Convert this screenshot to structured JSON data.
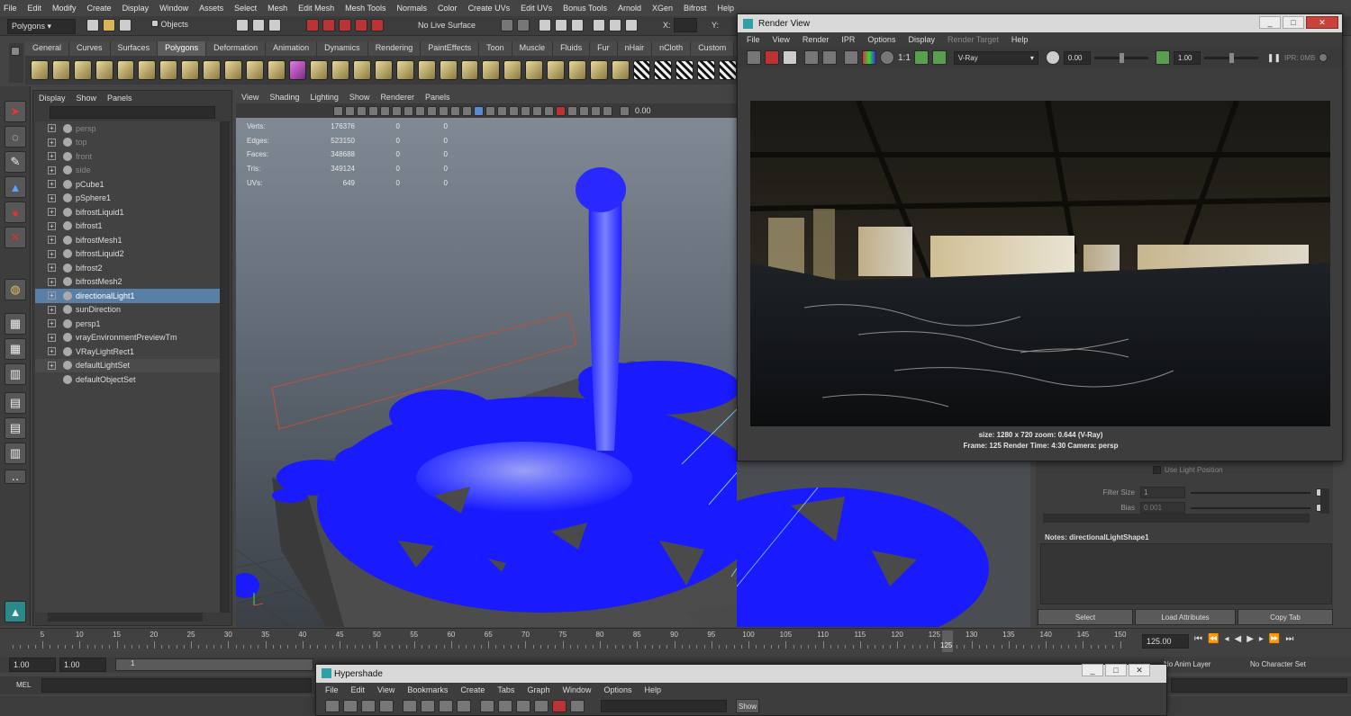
{
  "main_menu": [
    "File",
    "Edit",
    "Modify",
    "Create",
    "Display",
    "Window",
    "Assets",
    "Select",
    "Mesh",
    "Edit Mesh",
    "Mesh Tools",
    "Normals",
    "Color",
    "Create UVs",
    "Edit UVs",
    "Bonus Tools",
    "Arnold",
    "XGen",
    "Bifrost",
    "Help"
  ],
  "status_line": {
    "mode": "Polygons",
    "selection_mode": "Objects",
    "live_surface": "No Live Surface",
    "x_label": "X:",
    "y_label": "Y:"
  },
  "shelf_tabs": [
    "General",
    "Curves",
    "Surfaces",
    "Polygons",
    "Deformation",
    "Animation",
    "Dynamics",
    "Rendering",
    "PaintEffects",
    "Toon",
    "Muscle",
    "Fluids",
    "Fur",
    "nHair",
    "nCloth",
    "Custom"
  ],
  "shelf_active": "Polygons",
  "outliner": {
    "menu": [
      "Display",
      "Show",
      "Panels"
    ],
    "items": [
      {
        "label": "persp",
        "state": "dim"
      },
      {
        "label": "top",
        "state": "dim"
      },
      {
        "label": "front",
        "state": "dim"
      },
      {
        "label": "side",
        "state": "dim"
      },
      {
        "label": "pCube1",
        "state": "normal"
      },
      {
        "label": "pSphere1",
        "state": "normal"
      },
      {
        "label": "bifrostLiquid1",
        "state": "normal"
      },
      {
        "label": "bifrost1",
        "state": "normal"
      },
      {
        "label": "bifrostMesh1",
        "state": "normal"
      },
      {
        "label": "bifrostLiquid2",
        "state": "normal"
      },
      {
        "label": "bifrost2",
        "state": "normal"
      },
      {
        "label": "bifrostMesh2",
        "state": "normal"
      },
      {
        "label": "directionalLight1",
        "state": "selected"
      },
      {
        "label": "sunDirection",
        "state": "normal"
      },
      {
        "label": "persp1",
        "state": "normal"
      },
      {
        "label": "vrayEnvironmentPreviewTm",
        "state": "normal"
      },
      {
        "label": "VRayLightRect1",
        "state": "normal"
      },
      {
        "label": "defaultLightSet",
        "state": "highlight"
      },
      {
        "label": "defaultObjectSet",
        "state": "normal"
      }
    ]
  },
  "viewport": {
    "menu": [
      "View",
      "Shading",
      "Lighting",
      "Show",
      "Renderer",
      "Panels"
    ],
    "field_value": "0.00",
    "hud": [
      {
        "label": "Verts:",
        "v1": "176376",
        "v2": "0",
        "v3": "0"
      },
      {
        "label": "Edges:",
        "v1": "523150",
        "v2": "0",
        "v3": "0"
      },
      {
        "label": "Faces:",
        "v1": "348688",
        "v2": "0",
        "v3": "0"
      },
      {
        "label": "Tris:",
        "v1": "349124",
        "v2": "0",
        "v3": "0"
      },
      {
        "label": "UVs:",
        "v1": "649",
        "v2": "0",
        "v3": "0"
      }
    ]
  },
  "render_view": {
    "title": "Render View",
    "menu": [
      "File",
      "View",
      "Render",
      "IPR",
      "Options",
      "Display"
    ],
    "menu_disabled": "Render Target",
    "menu_help": "Help",
    "ratio": "1:1",
    "renderer": "V-Ray",
    "exposure": "0.00",
    "gamma": "1.00",
    "ipr_label": "IPR: 0MB",
    "status_line1": "size: 1280 x 720  zoom: 0.644        (V-Ray)",
    "status_line2": "Frame: 125        Render Time: 4:30        Camera: persp"
  },
  "attribute_editor": {
    "use_light_position": "Use Light Position",
    "filter_size_label": "Filter Size",
    "filter_size_value": "1",
    "bias_label": "Bias",
    "bias_value": "0.001",
    "notes_label": "Notes:  directionalLightShape1",
    "select_button": "Select",
    "load_attributes_button": "Load Attributes",
    "copy_tab_button": "Copy Tab"
  },
  "timeline": {
    "ticks": [
      "5",
      "10",
      "15",
      "20",
      "25",
      "30",
      "35",
      "40",
      "45",
      "50",
      "55",
      "60",
      "65",
      "70",
      "75",
      "80",
      "85",
      "90",
      "95",
      "100",
      "105",
      "110",
      "115",
      "120",
      "125",
      "130",
      "135",
      "140",
      "145",
      "150"
    ],
    "current_frame": "125",
    "current_time_field": "125.00"
  },
  "range_slider": {
    "start": "1.00",
    "start2": "1.00",
    "slider_text": "1",
    "anim_layer": "No Anim Layer",
    "character_set": "No Character Set"
  },
  "command_line": {
    "label": "MEL"
  },
  "hypershade": {
    "title": "Hypershade",
    "menu": [
      "File",
      "Edit",
      "View",
      "Bookmarks",
      "Create",
      "Tabs",
      "Graph",
      "Window",
      "Options",
      "Help"
    ],
    "show_button": "Show"
  },
  "colors": {
    "selection": "#5a7fa6",
    "liquid": "#1a1aff",
    "ui_bg": "#444444"
  }
}
